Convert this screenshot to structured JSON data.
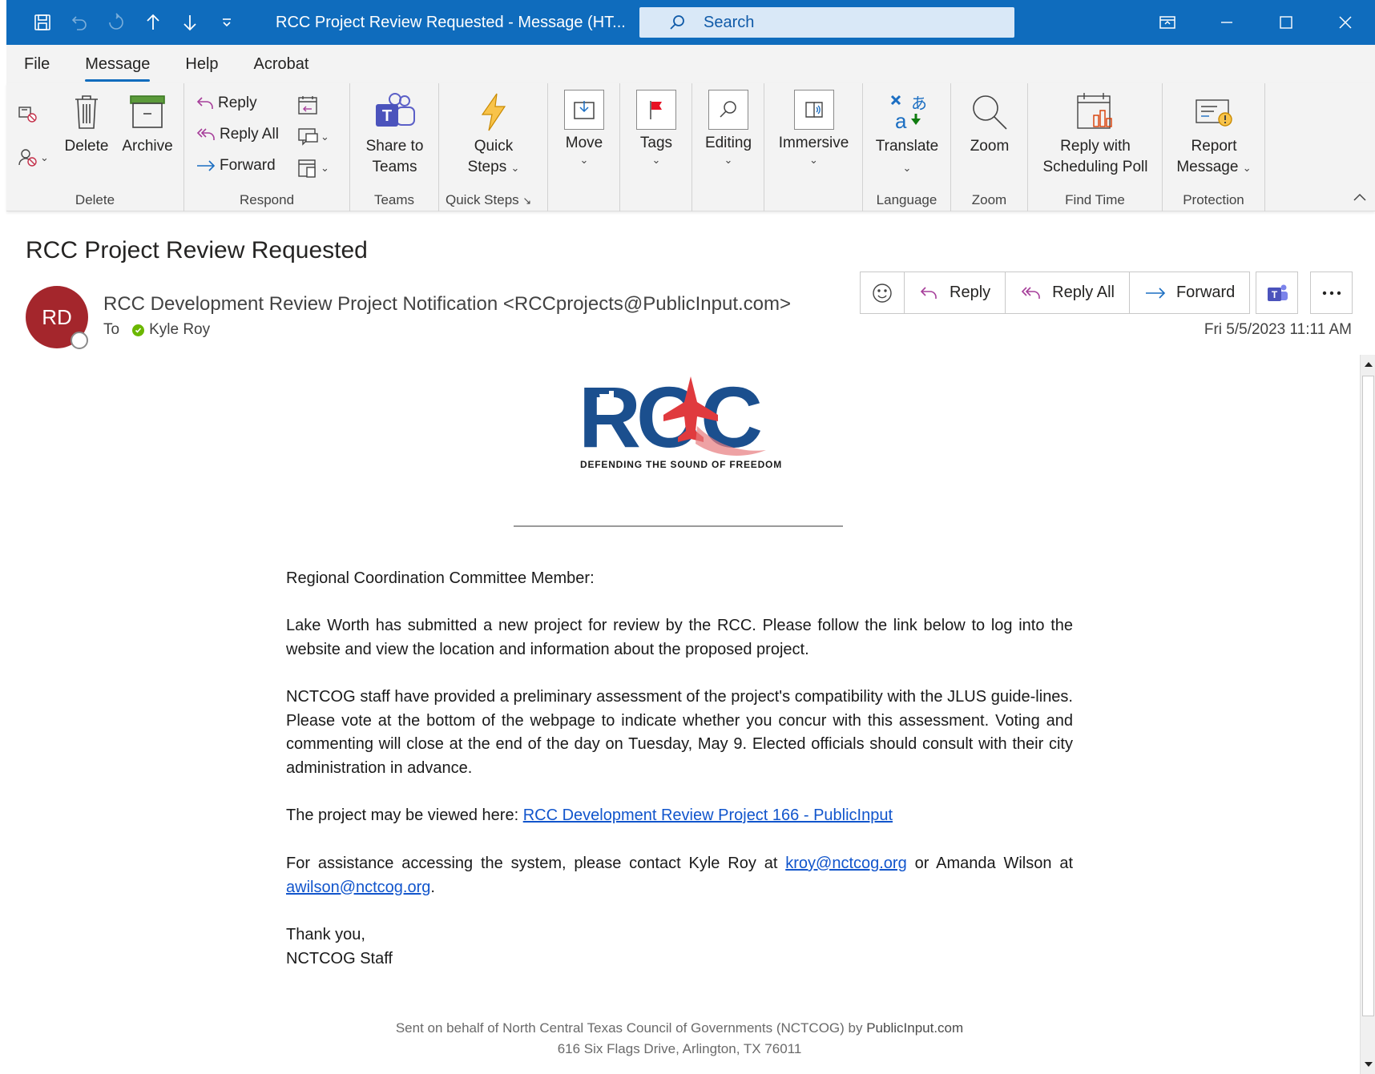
{
  "window": {
    "title": "RCC Project Review Requested  -  Message (HT...",
    "search_placeholder": "Search"
  },
  "ribbon_tabs": [
    "File",
    "Message",
    "Help",
    "Acrobat"
  ],
  "ribbon": {
    "delete_group": {
      "label": "Delete",
      "delete": "Delete",
      "archive": "Archive"
    },
    "respond_group": {
      "label": "Respond",
      "reply": "Reply",
      "reply_all": "Reply All",
      "forward": "Forward"
    },
    "teams_group": {
      "label": "Teams",
      "share_line1": "Share to",
      "share_line2": "Teams"
    },
    "quicksteps_group": {
      "label": "Quick Steps",
      "line1": "Quick",
      "line2": "Steps"
    },
    "move": "Move",
    "tags": "Tags",
    "editing": "Editing",
    "immersive": "Immersive",
    "language_group": {
      "label": "Language",
      "translate": "Translate"
    },
    "zoom_group": {
      "label": "Zoom",
      "zoom": "Zoom"
    },
    "findtime_group": {
      "label": "Find Time",
      "line1": "Reply with",
      "line2": "Scheduling Poll"
    },
    "protection_group": {
      "label": "Protection",
      "line1": "Report",
      "line2": "Message"
    }
  },
  "message": {
    "subject": "RCC Project Review Requested",
    "avatar_initials": "RD",
    "sender": "RCC Development Review Project Notification <RCCprojects@PublicInput.com>",
    "to_label": "To",
    "recipient": "Kyle Roy",
    "date": "Fri 5/5/2023 11:11 AM",
    "actions": {
      "reply": "Reply",
      "reply_all": "Reply All",
      "forward": "Forward"
    }
  },
  "logo": {
    "text": "RCC",
    "tagline": "DEFENDING THE SOUND OF FREEDOM"
  },
  "body": {
    "greeting": "Regional Coordination Committee Member:",
    "p1": "Lake Worth has submitted a new project for review by the RCC. Please follow the link below to log into the website and view the location and information about the proposed project.",
    "p2": "NCTCOG staff have provided a preliminary assessment of the project's compatibility with the JLUS guide-lines. Please vote at the bottom of the webpage to indicate whether you concur with this assessment. Voting and commenting will close at the end of the day on Tuesday, May 9. Elected officials should consult with their city administration in advance.",
    "p3_prefix": "The project may be viewed here: ",
    "p3_link": "RCC Development Review Project 166 - PublicInput",
    "p4_prefix": "For assistance accessing the system, please contact Kyle Roy at ",
    "p4_link1": "kroy@nctcog.org",
    "p4_mid": " or Amanda Wilson at ",
    "p4_link2": "awilson@nctcog.org",
    "p4_suffix": ".",
    "signoff1": "Thank you,",
    "signoff2": "NCTCOG Staff"
  },
  "footer": {
    "line1_prefix": "Sent on behalf of North Central Texas Council of Governments (NCTCOG) by ",
    "line1_brand": "PublicInput.com",
    "line2": "616 Six Flags Drive, Arlington, TX 76011"
  },
  "colors": {
    "titlebar": "#0f6cbd",
    "avatar": "#a4262c",
    "link": "#1155cc",
    "presence": "#6bb700"
  },
  "icons": [
    "save-icon",
    "undo-icon",
    "redo-icon",
    "up-arrow-icon",
    "down-arrow-icon",
    "customize-icon",
    "search-icon",
    "ribbon-display-icon",
    "minimize-icon",
    "maximize-icon",
    "close-icon"
  ]
}
